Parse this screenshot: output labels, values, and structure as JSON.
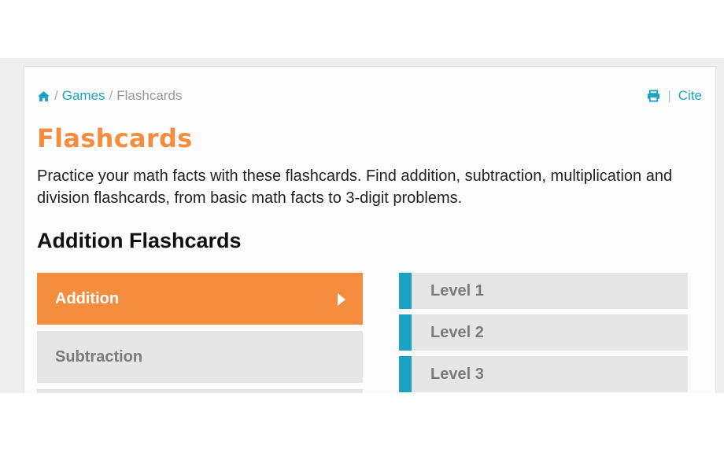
{
  "breadcrumb": {
    "home_icon": "home-icon",
    "separator": "/",
    "items": [
      {
        "label": "Games",
        "link": true
      },
      {
        "label": "Flashcards",
        "link": false
      }
    ]
  },
  "tools": {
    "print_icon": "printer-icon",
    "divider": "|",
    "cite_label": "Cite"
  },
  "page": {
    "title": "Flashcards",
    "intro": "Practice your math facts with these flashcards. Find addition, subtraction, multiplication and division flashcards, from basic math facts to 3-digit problems.",
    "section_title": "Addition Flashcards"
  },
  "categories": [
    {
      "label": "Addition",
      "active": true
    },
    {
      "label": "Subtraction",
      "active": false
    },
    {
      "label": "",
      "active": false
    }
  ],
  "levels": [
    {
      "label": "Level 1"
    },
    {
      "label": "Level 2"
    },
    {
      "label": "Level 3"
    }
  ],
  "colors": {
    "accent_orange": "#f58d3f",
    "accent_teal": "#1ba3c4",
    "item_gray": "#e6e6e6"
  }
}
